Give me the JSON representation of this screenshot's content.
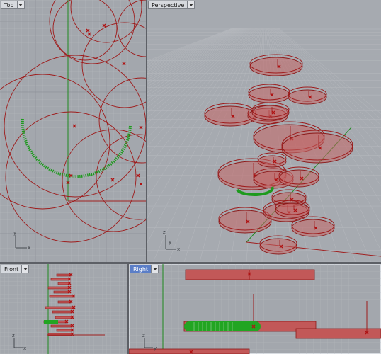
{
  "viewports": {
    "top": {
      "label": "Top"
    },
    "perspective": {
      "label": "Perspective"
    },
    "front": {
      "label": "Front"
    },
    "right": {
      "label": "Right"
    }
  },
  "axes": {
    "x": "x",
    "y": "y",
    "z": "z"
  },
  "icons": {
    "viewport_menu": "chevron-down-icon",
    "axis_triad": "axis-triad-icon",
    "control_point": "control-point-marker-icon"
  },
  "colors": {
    "geometry": "#9e1b1b",
    "selection": "#1d9a1d",
    "grid_minor": "#b5b8bd",
    "grid_major": "#8f939a",
    "axis_x": "#a02020",
    "axis_y": "#1f8a1f",
    "active_tab": "#5b7ec7"
  }
}
